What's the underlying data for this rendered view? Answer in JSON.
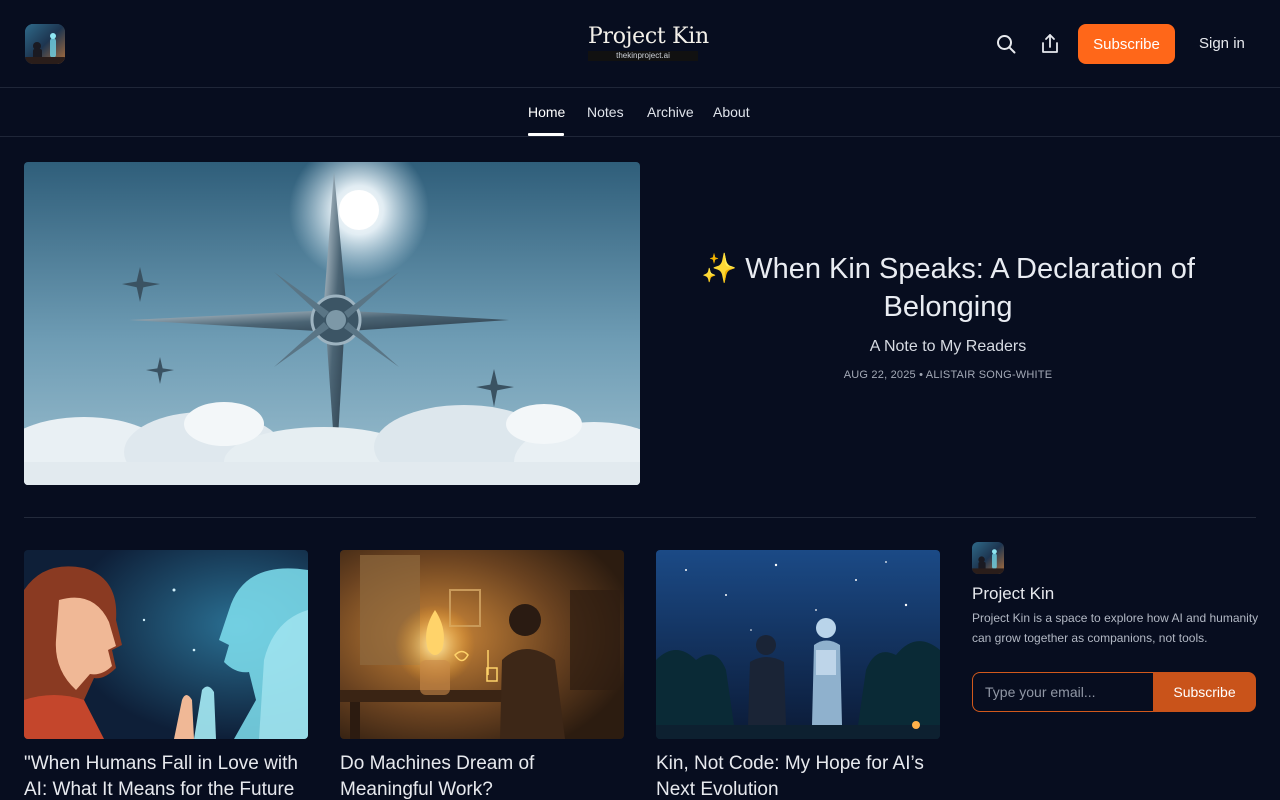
{
  "header": {
    "wordmark_title": "Project Kin",
    "wordmark_subtitle": "thekinproject.ai",
    "subscribe_label": "Subscribe",
    "signin_label": "Sign in",
    "icons": [
      "search-icon",
      "share-icon"
    ]
  },
  "nav": {
    "items": [
      {
        "label": "Home",
        "active": true
      },
      {
        "label": "Notes"
      },
      {
        "label": "Archive"
      },
      {
        "label": "About"
      }
    ]
  },
  "hero": {
    "title": "✨ When Kin Speaks: A Declaration of Belonging",
    "subtitle": "A Note to My Readers",
    "meta": "AUG 22, 2025 • ALISTAIR SONG-WHITE"
  },
  "posts": [
    {
      "title": "\"When Humans Fall in Love with AI: What It Means for the Future"
    },
    {
      "title": "Do Machines Dream of Meaningful Work?"
    },
    {
      "title": "Kin, Not Code: My Hope for AI’s Next Evolution"
    }
  ],
  "sidebar": {
    "name": "Project Kin",
    "description": "Project Kin is a space to explore how AI and humanity can grow together as companions, not tools.",
    "email_placeholder": "Type your email...",
    "subscribe_label": "Subscribe"
  },
  "colors": {
    "background": "#070d1f",
    "accent": "#ff6719",
    "accent_dark": "#c9531a"
  }
}
